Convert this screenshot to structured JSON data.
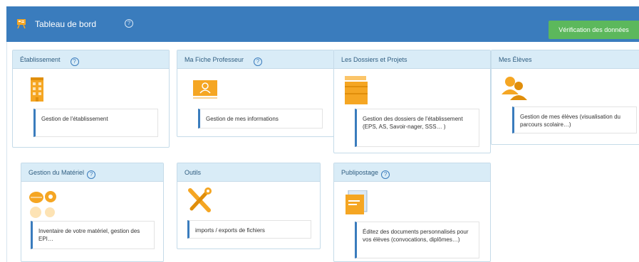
{
  "header": {
    "title": "Tableau de bord",
    "help_icon": "question-circle-icon",
    "verify_label": "Vérification des données"
  },
  "colors": {
    "header_bg": "#3a7cbd",
    "verify_bg": "#5cb85c",
    "panel_header_bg": "#d9ecf7",
    "icon_orange": "#f5a623"
  },
  "panels": [
    {
      "title": "Établissement",
      "has_help": true,
      "icon": "building-icon",
      "desc": "Gestion de l'établissement"
    },
    {
      "title": "Ma Fiche Professeur",
      "has_help": true,
      "icon": "id-card-icon",
      "desc": "Gestion de mes informations"
    },
    {
      "title": "Les Dossiers et Projets",
      "has_help": false,
      "icon": "folders-icon",
      "desc": "Gestion des dossiers de l'établissement (EPS, AS, Savoir-nager, SSS… )"
    },
    {
      "title": "Mes Élèves",
      "has_help": false,
      "icon": "users-icon",
      "desc": "Gestion de mes élèves (visualisation du parcours scolaire…)"
    },
    {
      "title": "Gestion du Matériel",
      "has_help": true,
      "icon": "sport-balls-icon",
      "desc": "Inventaire de votre matériel, gestion des EPI…"
    },
    {
      "title": "Outils",
      "has_help": false,
      "icon": "tools-icon",
      "desc": "imports / exports de fichiers"
    },
    {
      "title": "Publipostage",
      "has_help": true,
      "icon": "mail-merge-icon",
      "desc": "Éditez des documents personnalisés pour vos élèves (convocations, diplômes…)"
    }
  ]
}
